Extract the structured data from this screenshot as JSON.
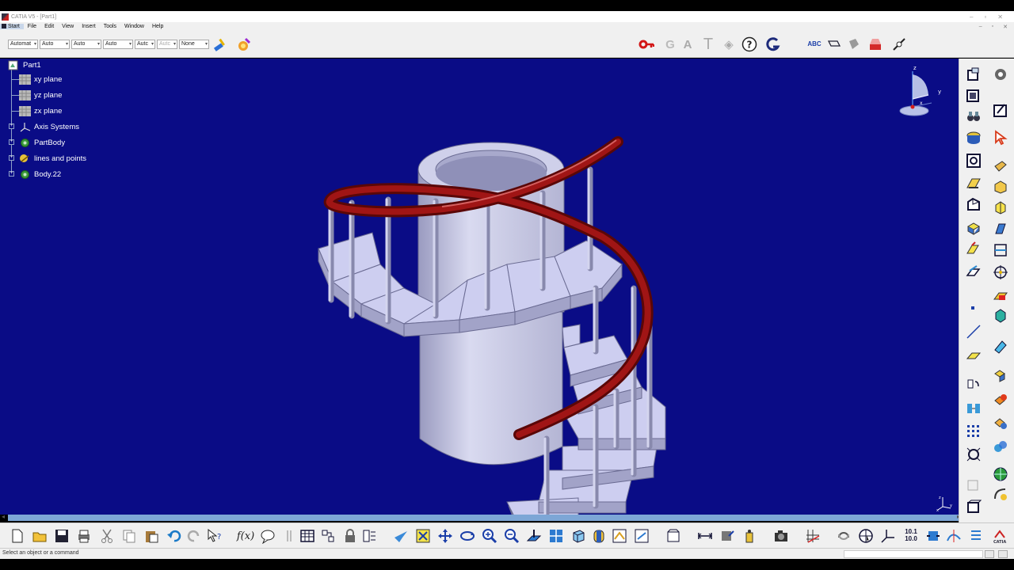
{
  "window": {
    "title": "CATIA V5 - [Part1]",
    "minimize": "–",
    "maximize": "▫",
    "close": "✕"
  },
  "menu": {
    "items": [
      "Start",
      "File",
      "Edit",
      "View",
      "Insert",
      "Tools",
      "Window",
      "Help"
    ],
    "mdi_minimize": "–",
    "mdi_restore": "▫",
    "mdi_close": "✕"
  },
  "graphic_properties": {
    "combos": [
      "Automat",
      "Auto",
      "Auto",
      "Auto",
      "Autc",
      "Autc",
      "None"
    ]
  },
  "top_icons": [
    {
      "name": "key-icon",
      "glyph": "🔑︎"
    },
    {
      "name": "gear-g-icon",
      "glyph": "G"
    },
    {
      "name": "text-a-icon",
      "glyph": "A"
    },
    {
      "name": "text-t-icon",
      "glyph": "T"
    },
    {
      "name": "eraser-icon",
      "glyph": "⌫"
    },
    {
      "name": "help-icon",
      "glyph": "?"
    },
    {
      "name": "catia-g-icon",
      "glyph": "G"
    },
    {
      "name": "abc-icon",
      "glyph": "ABC"
    },
    {
      "name": "dimension-icon",
      "glyph": "⊏"
    },
    {
      "name": "stamp-icon",
      "glyph": "⬢"
    },
    {
      "name": "cube-red-icon",
      "glyph": "⧉"
    },
    {
      "name": "measure-icon",
      "glyph": "⤢"
    }
  ],
  "tree": {
    "root": "Part1",
    "items": [
      {
        "label": "xy plane",
        "icon": "plane-icon"
      },
      {
        "label": "yz plane",
        "icon": "plane-icon"
      },
      {
        "label": "zx plane",
        "icon": "plane-icon"
      },
      {
        "label": "Axis Systems",
        "icon": "axis-icon"
      },
      {
        "label": "PartBody",
        "icon": "gear-icon"
      },
      {
        "label": "lines and points",
        "icon": "geoset-icon"
      },
      {
        "label": "Body.22",
        "icon": "gear-icon"
      }
    ]
  },
  "compass": {
    "z": "z",
    "y": "y",
    "x": "x"
  },
  "mini_axis": {
    "z": "z",
    "x": "x",
    "y": "y"
  },
  "status": {
    "text": "Select an object or a command"
  },
  "colors": {
    "background": "#0a0c86",
    "stair": "#c8c9e6",
    "handrail": "#8a0d0d"
  }
}
